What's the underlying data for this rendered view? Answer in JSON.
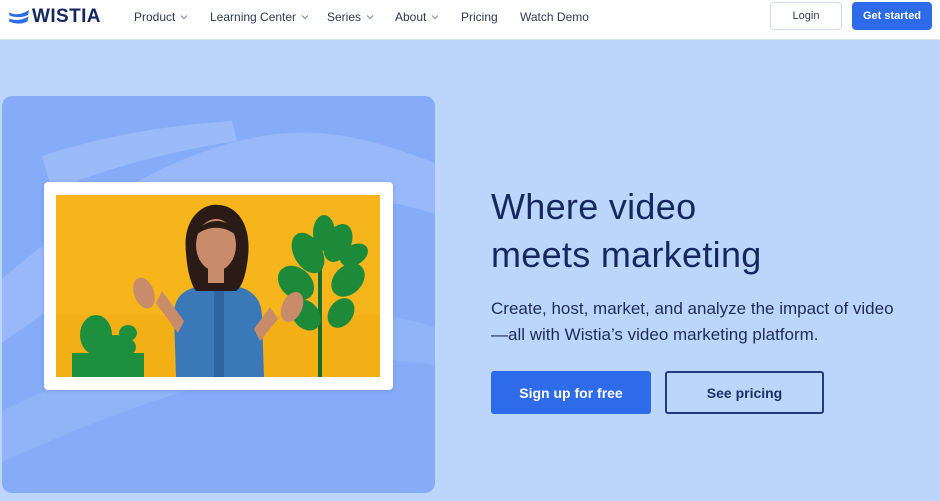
{
  "brand": {
    "name": "WISTIA",
    "logo_icon": "wistia-logo-icon"
  },
  "nav": {
    "items": [
      {
        "label": "Product",
        "has_dropdown": true
      },
      {
        "label": "Learning Center",
        "has_dropdown": true
      },
      {
        "label": "Series",
        "has_dropdown": true
      },
      {
        "label": "About",
        "has_dropdown": true
      },
      {
        "label": "Pricing",
        "has_dropdown": false
      },
      {
        "label": "Watch Demo",
        "has_dropdown": false
      }
    ],
    "login_label": "Login",
    "get_started_label": "Get started"
  },
  "hero": {
    "headline_line1": "Where video",
    "headline_line2": "meets marketing",
    "subhead_line1": "Create, host, market, and analyze the impact of video",
    "subhead_line2": "—all with Wistia’s video marketing platform.",
    "primary_cta": "Sign up for free",
    "secondary_cta": "See pricing"
  },
  "colors": {
    "background": "#bcd6fb",
    "panel": "#86acf8",
    "accent": "#2d6be8",
    "text_dark": "#16265e",
    "video_backdrop": "#f5b51b"
  }
}
